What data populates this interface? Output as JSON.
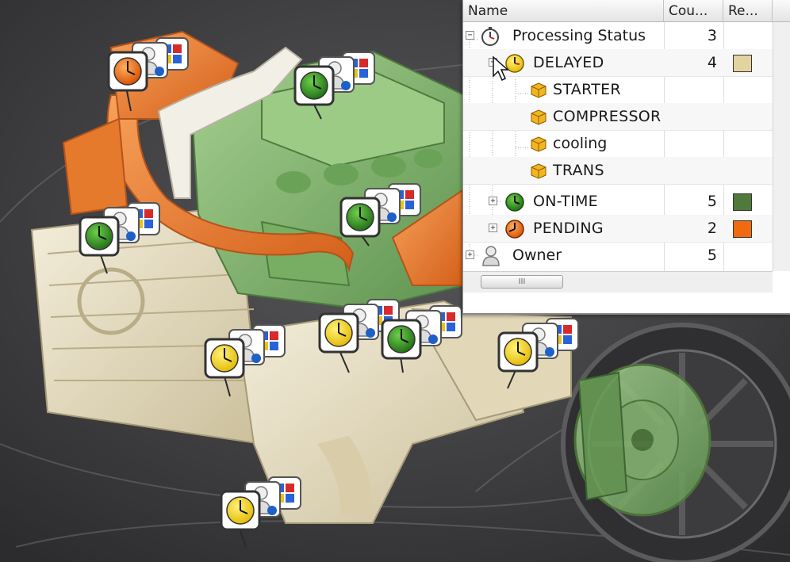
{
  "panel": {
    "columns": {
      "name": "Name",
      "count": "Cou...",
      "result": "Re..."
    },
    "rows": [
      {
        "label": "Processing Status",
        "count": "3",
        "icon": "stopwatch-icon",
        "color": ""
      },
      {
        "label": "DELAYED",
        "count": "4",
        "icon": "yellow-clock-icon",
        "color": "#e3d3a0"
      },
      {
        "label": "STARTER",
        "count": "",
        "icon": "cube-icon",
        "color": ""
      },
      {
        "label": "COMPRESSOR",
        "count": "",
        "icon": "cube-icon",
        "color": ""
      },
      {
        "label": "cooling",
        "count": "",
        "icon": "cube-icon",
        "color": ""
      },
      {
        "label": "TRANS",
        "count": "",
        "icon": "cube-icon",
        "color": ""
      },
      {
        "label": "ON-TIME",
        "count": "5",
        "icon": "green-clock-icon",
        "color": "#4f7a3a"
      },
      {
        "label": "PENDING",
        "count": "2",
        "icon": "orange-clock-icon",
        "color": "#f06a10"
      },
      {
        "label": "Owner",
        "count": "5",
        "icon": "user-icon",
        "color": ""
      }
    ],
    "hscroll_thumb": "III"
  },
  "colors": {
    "delayed": "#e3d3a0",
    "on_time": "#4f7a3a",
    "pending": "#f06a10",
    "engine_green": "#7fb46a",
    "engine_orange": "#e87a2a",
    "engine_cream": "#e8dfc2"
  },
  "markers": [
    {
      "status": "pending"
    },
    {
      "status": "on-time"
    },
    {
      "status": "on-time"
    },
    {
      "status": "on-time"
    },
    {
      "status": "delayed"
    },
    {
      "status": "on-time"
    },
    {
      "status": "delayed"
    },
    {
      "status": "delayed"
    },
    {
      "status": "delayed"
    }
  ]
}
